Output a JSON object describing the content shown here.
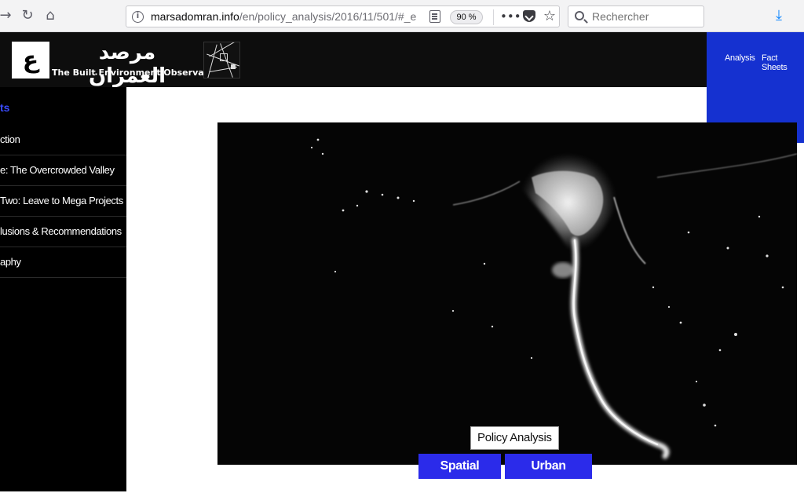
{
  "browser": {
    "url_host": "marsadomran.info",
    "url_path": "/en/policy_analysis/2016/11/501/#_e",
    "zoom": "90 %",
    "search_placeholder": "Rechercher",
    "back_icon": "arrow-right-icon",
    "reload_icon": "reload-icon",
    "home_icon": "home-icon",
    "more_icon": "•••",
    "bookmark_icon": "☆"
  },
  "site": {
    "logo_mark": "ع",
    "logo_ar": "مرصد العمران",
    "logo_en": "The Built Environment Observatory",
    "nav": [
      "Analysis",
      "Fact Sheets"
    ]
  },
  "sidebar": {
    "title": "ts",
    "items": [
      "ction",
      "e: The Overcrowded Valley",
      "Two: Leave to Mega Projects",
      "lusions & Recommendations",
      "aphy"
    ]
  },
  "hero": {
    "tag": "Policy Analysis",
    "categories": [
      "Spatial Justice",
      "Urban Planning"
    ]
  }
}
